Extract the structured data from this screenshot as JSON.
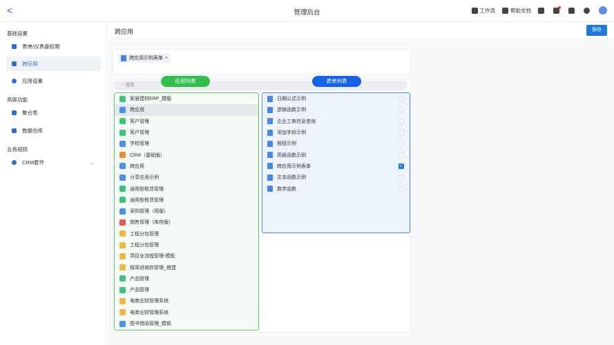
{
  "header": {
    "title": "管理后台",
    "back": "<",
    "tools": [
      {
        "icon": "workflow-icon",
        "label": "工作流"
      },
      {
        "icon": "doc-icon",
        "label": "帮助文档"
      }
    ]
  },
  "sidebar": {
    "groups": [
      {
        "label": "基础设置"
      },
      {
        "label": "高级功能"
      },
      {
        "label": "业务规则"
      }
    ],
    "items": [
      {
        "label": "表单/仪表盘权限"
      },
      {
        "label": "跨应用"
      },
      {
        "label": "应用设置"
      },
      {
        "label": "聚合表"
      },
      {
        "label": "数据仓库"
      },
      {
        "label": "CRM套件"
      }
    ]
  },
  "content": {
    "title": "跨应用",
    "save_label": "保存",
    "selected_tag": "跨应用示例表单",
    "tag_close": "×",
    "search_placeholder": "搜索",
    "app_list_label": "应用列表",
    "form_list_label": "表单列表"
  },
  "apps": [
    {
      "name": "家居建材ERP_模版",
      "color": "#3cc47c"
    },
    {
      "name": "跨应用",
      "color": "#4d8ef0"
    },
    {
      "name": "客户管理",
      "color": "#3cc47c"
    },
    {
      "name": "客户管理",
      "color": "#3cc47c"
    },
    {
      "name": "学校管理",
      "color": "#4d8ef0"
    },
    {
      "name": "CRM（基础版）",
      "color": "#f08a2c"
    },
    {
      "name": "跨应用",
      "color": "#4d8ef0"
    },
    {
      "name": "分享应用示例",
      "color": "#4d8ef0"
    },
    {
      "name": "通用型租赁管理",
      "color": "#3cc47c"
    },
    {
      "name": "通用型租赁管理",
      "color": "#3cc47c"
    },
    {
      "name": "采购管理（简版）",
      "color": "#4d8ef0"
    },
    {
      "name": "销售管理（库存版）",
      "color": "#e9574e"
    },
    {
      "name": "工程分包管理",
      "color": "#f0b840"
    },
    {
      "name": "工程分包管理",
      "color": "#f0b840"
    },
    {
      "name": "项目全流程管理-模板",
      "color": "#f0b840"
    },
    {
      "name": "极简进销存管理_搭建",
      "color": "#f0b840"
    },
    {
      "name": "产品管理",
      "color": "#3cc47c"
    },
    {
      "name": "产品管理",
      "color": "#3cc47c"
    },
    {
      "name": "电商业财管理系统",
      "color": "#f0b840"
    },
    {
      "name": "电商业财管理系统",
      "color": "#f0b840"
    },
    {
      "name": "图书借阅管理_模板",
      "color": "#4d8ef0"
    }
  ],
  "forms": [
    {
      "name": "日期公式示例",
      "checked": false
    },
    {
      "name": "逻辑函数示例",
      "checked": false
    },
    {
      "name": "企业工商信息查询",
      "checked": false
    },
    {
      "name": "添加字段示例",
      "checked": false
    },
    {
      "name": "按钮示例",
      "checked": false
    },
    {
      "name": "高级函数示例",
      "checked": false
    },
    {
      "name": "跨应用示例表单",
      "checked": true
    },
    {
      "name": "文本函数示例",
      "checked": false
    },
    {
      "name": "数学函数",
      "checked": false
    }
  ]
}
